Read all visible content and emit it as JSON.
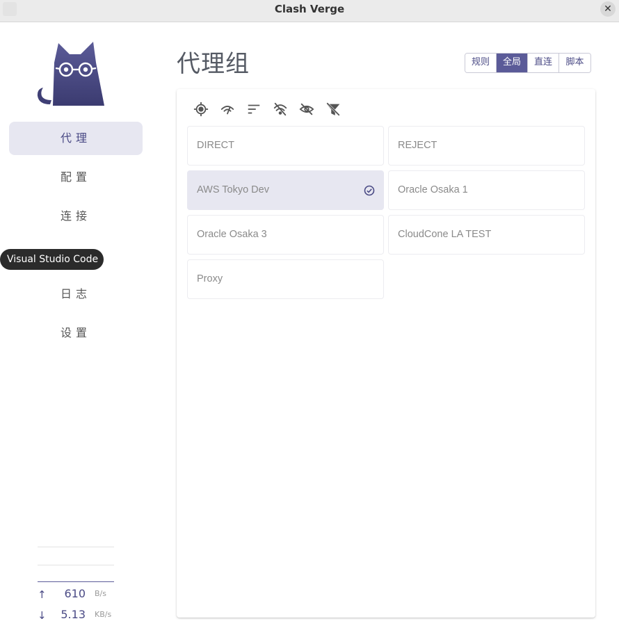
{
  "window": {
    "title": "Clash Verge",
    "close_glyph": "✕"
  },
  "nav": {
    "items": [
      {
        "label": "代理",
        "active": true
      },
      {
        "label": "配置",
        "active": false
      },
      {
        "label": "连接",
        "active": false
      },
      {
        "label": "",
        "active": false
      },
      {
        "label": "日志",
        "active": false
      },
      {
        "label": "设置",
        "active": false
      }
    ]
  },
  "tooltip": {
    "text": "Visual Studio Code"
  },
  "traffic": {
    "up": {
      "arrow": "↑",
      "value": "610",
      "unit": "B/s"
    },
    "down": {
      "arrow": "↓",
      "value": "5.13",
      "unit": "KB/s"
    }
  },
  "page": {
    "title": "代理组"
  },
  "modes": {
    "items": [
      "规则",
      "全局",
      "直连",
      "脚本"
    ],
    "active": "全局"
  },
  "toolbar": {
    "icons": [
      "locate-icon",
      "speed-test-icon",
      "sort-icon",
      "filter-delay-icon",
      "hide-icon",
      "filter-off-icon"
    ]
  },
  "proxies": [
    {
      "name": "DIRECT",
      "selected": false
    },
    {
      "name": "REJECT",
      "selected": false
    },
    {
      "name": "AWS Tokyo Dev",
      "selected": true
    },
    {
      "name": "Oracle Osaka 1",
      "selected": false
    },
    {
      "name": "Oracle Osaka 3",
      "selected": false
    },
    {
      "name": "CloudCone LA TEST",
      "selected": false
    },
    {
      "name": "Proxy",
      "selected": false
    }
  ],
  "colors": {
    "accent": "#5b5b98",
    "selected_bg": "#e7e7f1",
    "text_muted": "#8a8a8a"
  }
}
